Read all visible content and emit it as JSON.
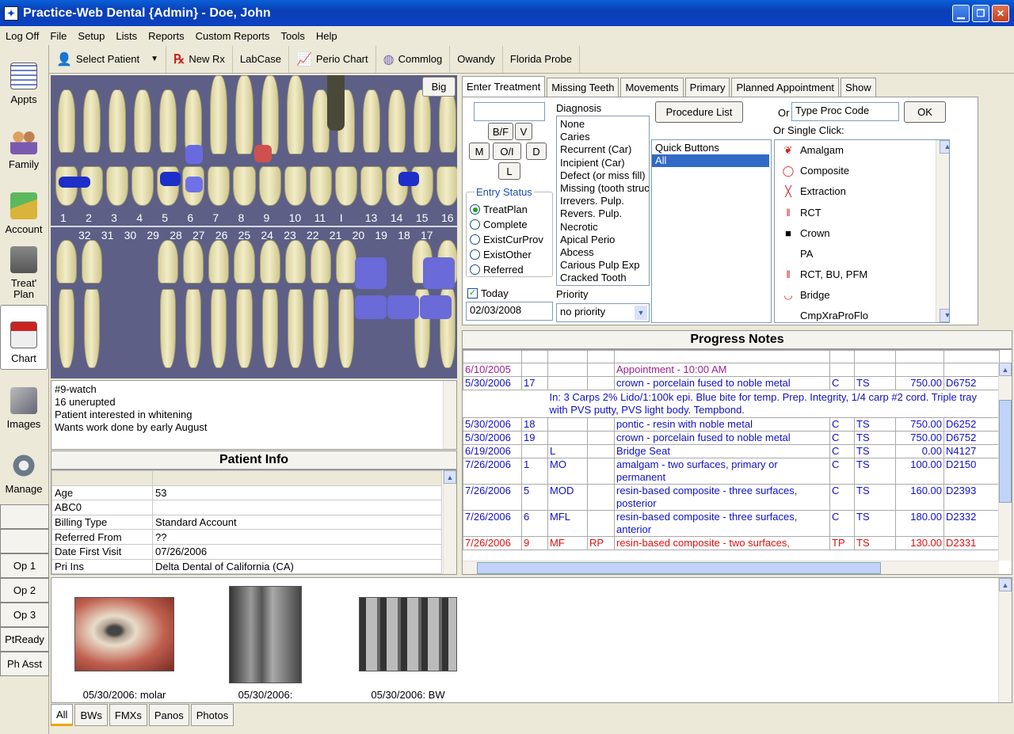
{
  "window": {
    "title": "Practice-Web Dental {Admin} - Doe, John"
  },
  "menu": [
    "Log Off",
    "File",
    "Setup",
    "Lists",
    "Reports",
    "Custom Reports",
    "Tools",
    "Help"
  ],
  "modules": [
    "Appts",
    "Family",
    "Account",
    "Treat' Plan",
    "Chart",
    "Images",
    "Manage"
  ],
  "ops": [
    "Op 1",
    "Op 2",
    "Op 3",
    "PtReady",
    "Ph Asst"
  ],
  "toolbar": {
    "select_patient": "Select Patient",
    "new_rx": "New Rx",
    "labcase": "LabCase",
    "perio_chart": "Perio Chart",
    "commlog": "Commlog",
    "owandy": "Owandy",
    "florida_probe": "Florida Probe"
  },
  "chart": {
    "big": "Big",
    "upper_numbers": [
      "1",
      "2",
      "3",
      "4",
      "5",
      "6",
      "7",
      "8",
      "9",
      "10",
      "11",
      "I",
      "13",
      "14",
      "15",
      "16"
    ],
    "lower_numbers": [
      "32",
      "31",
      "30",
      "29",
      "28",
      "27",
      "26",
      "25",
      "24",
      "23",
      "22",
      "21",
      "20",
      "19",
      "18",
      "17"
    ]
  },
  "notes": [
    "#9-watch",
    "16 unerupted",
    "Patient interested in whitening",
    "Wants work done by early August"
  ],
  "patient_info": {
    "title": "Patient Info",
    "rows": [
      [
        "Age",
        "53"
      ],
      [
        "ABC0",
        ""
      ],
      [
        "Billing Type",
        "Standard Account"
      ],
      [
        "Referred From",
        "??"
      ],
      [
        "Date First Visit",
        "07/26/2006"
      ],
      [
        "Pri Ins",
        "Delta Dental of California (CA)"
      ]
    ]
  },
  "treat_tabs": [
    "Enter Treatment",
    "Missing Teeth",
    "Movements",
    "Primary",
    "Planned Appointment",
    "Show"
  ],
  "treatment": {
    "surfaces": [
      "B/F",
      "V",
      "M",
      "O/I",
      "D",
      "L"
    ],
    "diagnosis_label": "Diagnosis",
    "diagnosis": [
      "None",
      "Caries",
      "Recurrent (Car)",
      "Incipient (Car)",
      "Defect (or miss fill)",
      "Missing (tooth struc",
      "Irrevers. Pulp.",
      "Revers. Pulp.",
      "Necrotic",
      "Apical Perio",
      "Abcess",
      "Carious Pulp Exp",
      "Cracked Tooth"
    ],
    "entry_status_label": "Entry Status",
    "entry_status": [
      "TreatPlan",
      "Complete",
      "ExistCurProv",
      "ExistOther",
      "Referred"
    ],
    "today": "Today",
    "date": "02/03/2008",
    "priority_label": "Priority",
    "priority": "no priority",
    "procedure_list": "Procedure List",
    "quick_buttons": [
      "Quick Buttons",
      "All"
    ],
    "or": "Or",
    "type_proc_code": "Type Proc Code",
    "ok": "OK",
    "single_click": "Or Single Click:",
    "procs": [
      "Amalgam",
      "Composite",
      "Extraction",
      "RCT",
      "Crown",
      "PA",
      "RCT, BU, PFM",
      "Bridge",
      "CmpXraProFlo"
    ]
  },
  "progress_notes": {
    "title": "Progress Notes",
    "rows": [
      {
        "date": "6/10/2005",
        "tooth": "",
        "surf": "",
        "dx": "",
        "desc": "Appointment - 10:00 AM",
        "st": "",
        "prov": "",
        "fee": "",
        "code": "",
        "color": "#a0208c"
      },
      {
        "date": "5/30/2006",
        "tooth": "17",
        "surf": "",
        "dx": "",
        "desc": "crown - porcelain fused to noble metal",
        "st": "C",
        "prov": "TS",
        "fee": "750.00",
        "code": "D6752",
        "color": "#1010c8"
      },
      {
        "note": "In: 3 Carps 2% Lido/1:100k epi. Blue bite for temp. Prep. Integrity, 1/4 carp #2 cord. Triple tray with PVS putty, PVS light body. Tempbond.",
        "color": "#1010c8"
      },
      {
        "date": "5/30/2006",
        "tooth": "18",
        "surf": "",
        "dx": "",
        "desc": "pontic - resin with noble metal",
        "st": "C",
        "prov": "TS",
        "fee": "750.00",
        "code": "D6252",
        "color": "#1010c8"
      },
      {
        "date": "5/30/2006",
        "tooth": "19",
        "surf": "",
        "dx": "",
        "desc": "crown - porcelain fused to noble metal",
        "st": "C",
        "prov": "TS",
        "fee": "750.00",
        "code": "D6752",
        "color": "#1010c8"
      },
      {
        "date": "6/19/2006",
        "tooth": "",
        "surf": "L",
        "dx": "",
        "desc": "Bridge Seat",
        "st": "C",
        "prov": "TS",
        "fee": "0.00",
        "code": "N4127",
        "color": "#1010c8"
      },
      {
        "date": "7/26/2006",
        "tooth": "1",
        "surf": "MO",
        "dx": "",
        "desc": "amalgam - two surfaces, primary or permanent",
        "st": "C",
        "prov": "TS",
        "fee": "100.00",
        "code": "D2150",
        "color": "#1010c8"
      },
      {
        "date": "7/26/2006",
        "tooth": "5",
        "surf": "MOD",
        "dx": "",
        "desc": "resin-based composite - three surfaces, posterior",
        "st": "C",
        "prov": "TS",
        "fee": "160.00",
        "code": "D2393",
        "color": "#1010c8"
      },
      {
        "date": "7/26/2006",
        "tooth": "6",
        "surf": "MFL",
        "dx": "",
        "desc": "resin-based composite - three surfaces, anterior",
        "st": "C",
        "prov": "TS",
        "fee": "180.00",
        "code": "D2332",
        "color": "#1010c8"
      },
      {
        "date": "7/26/2006",
        "tooth": "9",
        "surf": "MF",
        "dx": "RP",
        "desc": "resin-based composite - two surfaces,",
        "st": "TP",
        "prov": "TS",
        "fee": "130.00",
        "code": "D2331",
        "color": "#e01010"
      }
    ]
  },
  "images": [
    {
      "caption": "05/30/2006: molar"
    },
    {
      "caption": "05/30/2006:"
    },
    {
      "caption": "05/30/2006: BW"
    }
  ],
  "image_tabs": [
    "All",
    "BWs",
    "FMXs",
    "Panos",
    "Photos"
  ]
}
